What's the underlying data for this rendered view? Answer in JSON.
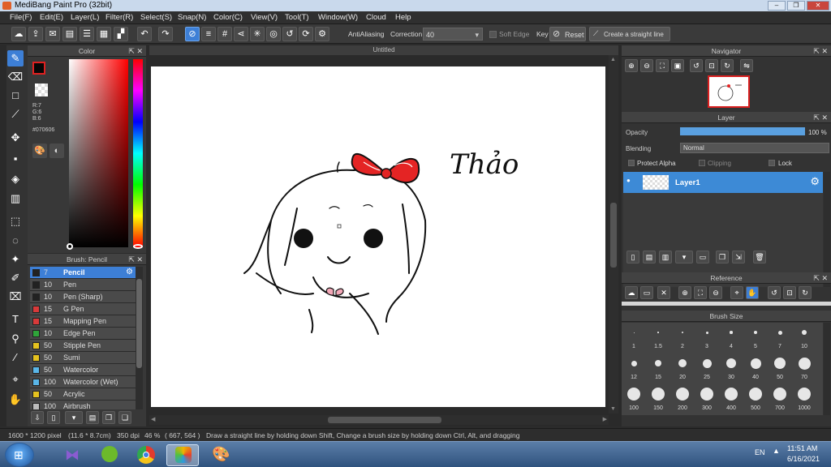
{
  "window": {
    "title": "MediBang Paint Pro (32bit)",
    "minimize": "‒",
    "restore": "❐",
    "close": "✕"
  },
  "menu": [
    "File(F)",
    "Edit(E)",
    "Layer(L)",
    "Filter(R)",
    "Select(S)",
    "Snap(N)",
    "Color(C)",
    "View(V)",
    "Tool(T)",
    "Window(W)",
    "Cloud",
    "Help"
  ],
  "toolbar": {
    "antialiasing_label": "AntiAliasing",
    "correction_label": "Correction",
    "correction_value": "40",
    "soft_edge_label": "Soft Edge",
    "key_label": "Key",
    "reset_label": "Reset",
    "straight_line_label": "Create a straight line"
  },
  "color_panel": {
    "title": "Color",
    "r": "R:7",
    "g": "G:6",
    "b": "B:6",
    "hex": "#070606",
    "primary": "#070606"
  },
  "brush_panel": {
    "title": "Brush: Pencil",
    "items": [
      {
        "size": "7",
        "name": "Pencil",
        "color": "#222222"
      },
      {
        "size": "10",
        "name": "Pen",
        "color": "#222222"
      },
      {
        "size": "10",
        "name": "Pen (Sharp)",
        "color": "#222222"
      },
      {
        "size": "15",
        "name": "G Pen",
        "color": "#d83a3a"
      },
      {
        "size": "15",
        "name": "Mapping Pen",
        "color": "#d83a3a"
      },
      {
        "size": "10",
        "name": "Edge Pen",
        "color": "#2fa53a"
      },
      {
        "size": "50",
        "name": "Stipple Pen",
        "color": "#e5c21f"
      },
      {
        "size": "50",
        "name": "Sumi",
        "color": "#e5c21f"
      },
      {
        "size": "50",
        "name": "Watercolor",
        "color": "#5ab6e8"
      },
      {
        "size": "100",
        "name": "Watercolor (Wet)",
        "color": "#5ab6e8"
      },
      {
        "size": "50",
        "name": "Acrylic",
        "color": "#e5c21f"
      },
      {
        "size": "100",
        "name": "Airbrush",
        "color": "#bbbbbb"
      }
    ]
  },
  "canvas": {
    "tab_title": "Untitled",
    "signature_text": "Thảo"
  },
  "navigator": {
    "title": "Navigator"
  },
  "layer_panel": {
    "title": "Layer",
    "opacity_label": "Opacity",
    "opacity_value": "100 %",
    "opacity_fraction": 1.0,
    "blending_label": "Blending",
    "blending_value": "Normal",
    "protect_alpha": "Protect Alpha",
    "clipping": "Clipping",
    "lock": "Lock",
    "layers": [
      {
        "name": "Layer1"
      }
    ]
  },
  "reference": {
    "title": "Reference"
  },
  "brush_size": {
    "title": "Brush Size",
    "sizes": [
      "1",
      "1.5",
      "2",
      "3",
      "4",
      "5",
      "7",
      "10",
      "12",
      "15",
      "20",
      "25",
      "30",
      "40",
      "50",
      "70",
      "100",
      "150",
      "200",
      "300",
      "400",
      "500",
      "700",
      "1000"
    ]
  },
  "status": {
    "dimensions": "1600 * 1200 pixel",
    "physical": "(11.6 * 8.7cm)",
    "dpi": "350 dpi",
    "zoom": "46 %",
    "coords": "( 667, 564 )",
    "hint": "Draw a straight line by holding down Shift, Change a brush size by holding down Ctrl, Alt, and dragging"
  },
  "taskbar": {
    "lang": "EN",
    "time": "11:51 AM",
    "date": "6/16/2021"
  }
}
